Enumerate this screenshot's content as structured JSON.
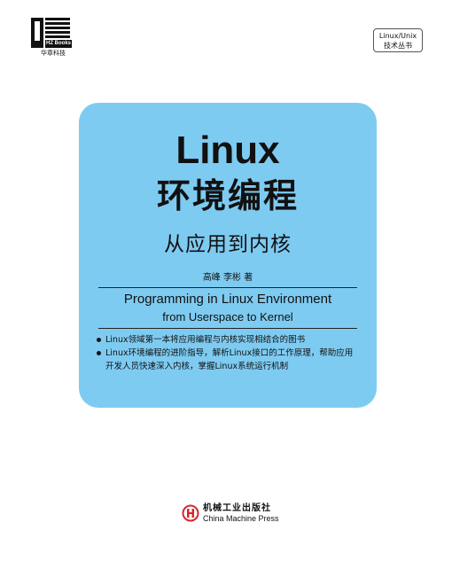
{
  "publisher_logo": {
    "imprint": "HZ Books",
    "caption": "华章科技"
  },
  "series_badge": {
    "line1": "Linux/Unix",
    "line2": "技术丛书"
  },
  "cover": {
    "title_en": "Linux",
    "title_zh": "环境编程",
    "subtitle_zh": "从应用到内核",
    "authors": "高峰 李彬 著",
    "english_title": "Programming in Linux Environment",
    "english_subtitle": "from Userspace to Kernel",
    "bullets": [
      "Linux领域第一本将应用编程与内核实现相结合的图书",
      "Linux环境编程的进阶指导，解析Linux接口的工作原理，帮助应用开发人员快速深入内核，掌握Linux系统运行机制"
    ]
  },
  "publisher": {
    "name_zh": "机械工业出版社",
    "name_en": "China Machine Press"
  },
  "colors": {
    "panel": "#7ecbf2",
    "logo_red": "#d9252b"
  }
}
